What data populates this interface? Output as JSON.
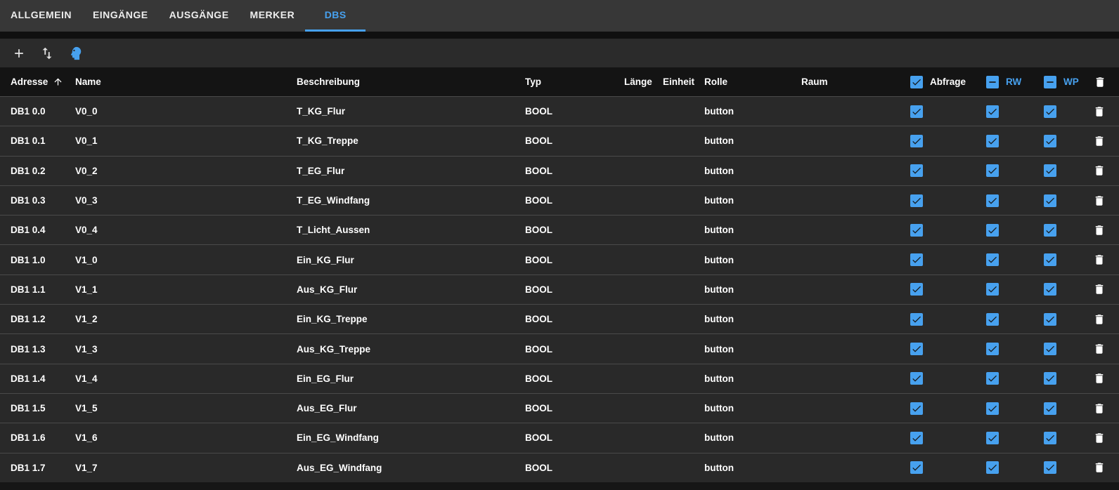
{
  "tabs": {
    "items": [
      {
        "label": "ALLGEMEIN",
        "active": false
      },
      {
        "label": "EINGÄNGE",
        "active": false
      },
      {
        "label": "AUSGÄNGE",
        "active": false
      },
      {
        "label": "MERKER",
        "active": false
      },
      {
        "label": "DBS",
        "active": true
      }
    ]
  },
  "toolbar": {
    "buttons": [
      {
        "name": "add-button",
        "icon": "plus-icon"
      },
      {
        "name": "sort-button",
        "icon": "swap-vert-icon"
      },
      {
        "name": "assistant-button",
        "icon": "head-icon",
        "color": "#47a1ef"
      }
    ]
  },
  "colors": {
    "accent": "#47a1ef",
    "tabbar_bg": "#373737",
    "toolbar_bg": "#2b2b2b",
    "table_header_bg": "#141414",
    "row_bg": "#292929",
    "text": "#ffffff"
  },
  "table": {
    "columns": [
      {
        "key": "adresse",
        "label": "Adresse",
        "type": "text",
        "sort": "asc"
      },
      {
        "key": "name",
        "label": "Name",
        "type": "text"
      },
      {
        "key": "beschreibung",
        "label": "Beschreibung",
        "type": "text"
      },
      {
        "key": "typ",
        "label": "Typ",
        "type": "text"
      },
      {
        "key": "laenge",
        "label": "Länge",
        "type": "text"
      },
      {
        "key": "einheit",
        "label": "Einheit",
        "type": "text"
      },
      {
        "key": "rolle",
        "label": "Rolle",
        "type": "text"
      },
      {
        "key": "raum",
        "label": "Raum",
        "type": "text"
      },
      {
        "key": "abfrage",
        "label": "Abfrage",
        "type": "checkbox",
        "state": "checked",
        "accent_label": false
      },
      {
        "key": "rw",
        "label": "RW",
        "type": "checkbox",
        "state": "indeterminate",
        "accent_label": true
      },
      {
        "key": "wp",
        "label": "WP",
        "type": "checkbox",
        "state": "indeterminate",
        "accent_label": true
      },
      {
        "key": "delete",
        "label": "",
        "type": "icon",
        "icon": "trash-icon"
      }
    ],
    "rows": [
      {
        "adresse": "DB1 0.0",
        "name": "V0_0",
        "beschreibung": "T_KG_Flur",
        "typ": "BOOL",
        "laenge": "",
        "einheit": "",
        "rolle": "button",
        "raum": "",
        "abfrage": true,
        "rw": true,
        "wp": true
      },
      {
        "adresse": "DB1 0.1",
        "name": "V0_1",
        "beschreibung": "T_KG_Treppe",
        "typ": "BOOL",
        "laenge": "",
        "einheit": "",
        "rolle": "button",
        "raum": "",
        "abfrage": true,
        "rw": true,
        "wp": true
      },
      {
        "adresse": "DB1 0.2",
        "name": "V0_2",
        "beschreibung": "T_EG_Flur",
        "typ": "BOOL",
        "laenge": "",
        "einheit": "",
        "rolle": "button",
        "raum": "",
        "abfrage": true,
        "rw": true,
        "wp": true
      },
      {
        "adresse": "DB1 0.3",
        "name": "V0_3",
        "beschreibung": "T_EG_Windfang",
        "typ": "BOOL",
        "laenge": "",
        "einheit": "",
        "rolle": "button",
        "raum": "",
        "abfrage": true,
        "rw": true,
        "wp": true
      },
      {
        "adresse": "DB1 0.4",
        "name": "V0_4",
        "beschreibung": "T_Licht_Aussen",
        "typ": "BOOL",
        "laenge": "",
        "einheit": "",
        "rolle": "button",
        "raum": "",
        "abfrage": true,
        "rw": true,
        "wp": true
      },
      {
        "adresse": "DB1 1.0",
        "name": "V1_0",
        "beschreibung": "Ein_KG_Flur",
        "typ": "BOOL",
        "laenge": "",
        "einheit": "",
        "rolle": "button",
        "raum": "",
        "abfrage": true,
        "rw": true,
        "wp": true
      },
      {
        "adresse": "DB1 1.1",
        "name": "V1_1",
        "beschreibung": "Aus_KG_Flur",
        "typ": "BOOL",
        "laenge": "",
        "einheit": "",
        "rolle": "button",
        "raum": "",
        "abfrage": true,
        "rw": true,
        "wp": true
      },
      {
        "adresse": "DB1 1.2",
        "name": "V1_2",
        "beschreibung": "Ein_KG_Treppe",
        "typ": "BOOL",
        "laenge": "",
        "einheit": "",
        "rolle": "button",
        "raum": "",
        "abfrage": true,
        "rw": true,
        "wp": true
      },
      {
        "adresse": "DB1 1.3",
        "name": "V1_3",
        "beschreibung": "Aus_KG_Treppe",
        "typ": "BOOL",
        "laenge": "",
        "einheit": "",
        "rolle": "button",
        "raum": "",
        "abfrage": true,
        "rw": true,
        "wp": true
      },
      {
        "adresse": "DB1 1.4",
        "name": "V1_4",
        "beschreibung": "Ein_EG_Flur",
        "typ": "BOOL",
        "laenge": "",
        "einheit": "",
        "rolle": "button",
        "raum": "",
        "abfrage": true,
        "rw": true,
        "wp": true
      },
      {
        "adresse": "DB1 1.5",
        "name": "V1_5",
        "beschreibung": "Aus_EG_Flur",
        "typ": "BOOL",
        "laenge": "",
        "einheit": "",
        "rolle": "button",
        "raum": "",
        "abfrage": true,
        "rw": true,
        "wp": true
      },
      {
        "adresse": "DB1 1.6",
        "name": "V1_6",
        "beschreibung": "Ein_EG_Windfang",
        "typ": "BOOL",
        "laenge": "",
        "einheit": "",
        "rolle": "button",
        "raum": "",
        "abfrage": true,
        "rw": true,
        "wp": true
      },
      {
        "adresse": "DB1 1.7",
        "name": "V1_7",
        "beschreibung": "Aus_EG_Windfang",
        "typ": "BOOL",
        "laenge": "",
        "einheit": "",
        "rolle": "button",
        "raum": "",
        "abfrage": true,
        "rw": true,
        "wp": true
      }
    ]
  }
}
